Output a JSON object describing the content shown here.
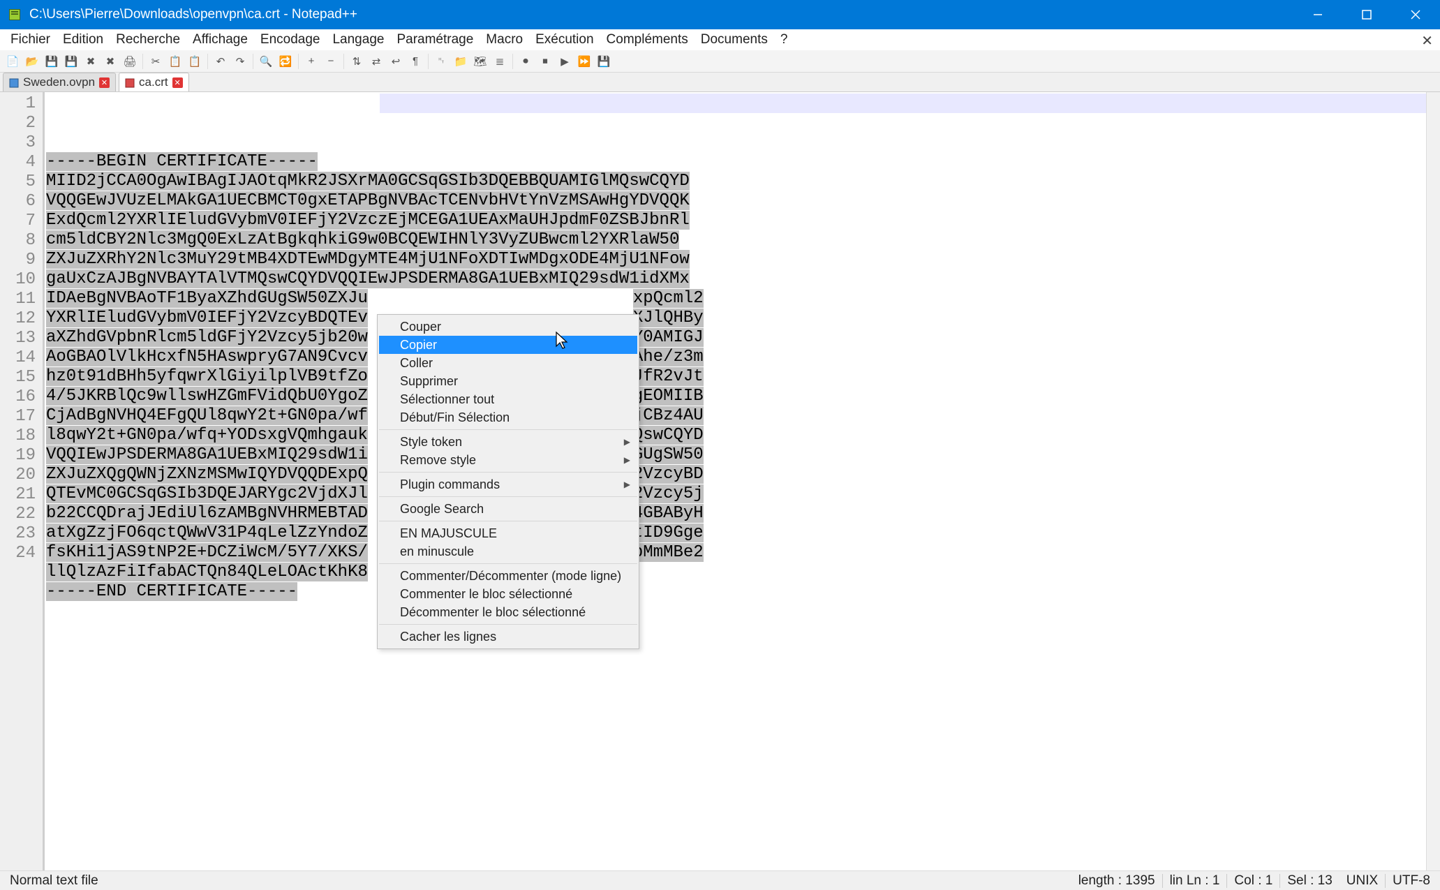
{
  "window": {
    "title": "C:\\Users\\Pierre\\Downloads\\openvpn\\ca.crt - Notepad++"
  },
  "menubar": {
    "items": [
      "Fichier",
      "Edition",
      "Recherche",
      "Affichage",
      "Encodage",
      "Langage",
      "Paramétrage",
      "Macro",
      "Exécution",
      "Compléments",
      "Documents",
      "?"
    ]
  },
  "toolbar_icons": [
    {
      "name": "new-file-icon",
      "glyph": "📄"
    },
    {
      "name": "open-file-icon",
      "glyph": "📂"
    },
    {
      "name": "save-icon",
      "glyph": "💾"
    },
    {
      "name": "save-all-icon",
      "glyph": "💾"
    },
    {
      "name": "close-icon",
      "glyph": "✖"
    },
    {
      "name": "close-all-icon",
      "glyph": "✖"
    },
    {
      "name": "print-icon",
      "glyph": "🖨"
    },
    {
      "sep": true
    },
    {
      "name": "cut-icon",
      "glyph": "✂"
    },
    {
      "name": "copy-icon",
      "glyph": "📋"
    },
    {
      "name": "paste-icon",
      "glyph": "📋"
    },
    {
      "sep": true
    },
    {
      "name": "undo-icon",
      "glyph": "↶"
    },
    {
      "name": "redo-icon",
      "glyph": "↷"
    },
    {
      "sep": true
    },
    {
      "name": "find-icon",
      "glyph": "🔍"
    },
    {
      "name": "replace-icon",
      "glyph": "🔁"
    },
    {
      "sep": true
    },
    {
      "name": "zoom-in-icon",
      "glyph": "+"
    },
    {
      "name": "zoom-out-icon",
      "glyph": "−"
    },
    {
      "sep": true
    },
    {
      "name": "sync-v-icon",
      "glyph": "⇅"
    },
    {
      "name": "sync-h-icon",
      "glyph": "⇄"
    },
    {
      "name": "wrap-icon",
      "glyph": "↩"
    },
    {
      "name": "show-all-chars-icon",
      "glyph": "¶"
    },
    {
      "sep": true
    },
    {
      "name": "indent-guide-icon",
      "glyph": "␉"
    },
    {
      "name": "folder-as-workspace-icon",
      "glyph": "📁"
    },
    {
      "name": "doc-map-icon",
      "glyph": "🗺"
    },
    {
      "name": "func-list-icon",
      "glyph": "≣"
    },
    {
      "sep": true
    },
    {
      "name": "record-macro-icon",
      "glyph": "⏺"
    },
    {
      "name": "stop-macro-icon",
      "glyph": "⏹"
    },
    {
      "name": "play-macro-icon",
      "glyph": "▶"
    },
    {
      "name": "play-multi-icon",
      "glyph": "⏩"
    },
    {
      "name": "save-macro-icon",
      "glyph": "💾"
    }
  ],
  "tabs": [
    {
      "label": "Sweden.ovpn",
      "active": false,
      "dirty": false
    },
    {
      "label": "ca.crt",
      "active": true,
      "dirty": true
    }
  ],
  "lines_full": [
    "-----BEGIN CERTIFICATE-----",
    "MIID2jCCA0OgAwIBAgIJAOtqMkR2JSXrMA0GCSqGSIb3DQEBBQUAMIGlMQswCQYD",
    "VQQGEwJVUzELMAkGA1UECBMCT0gxETAPBgNVBAcTCENvbHVtYnVzMSAwHgYDVQQK",
    "ExdQcml2YXRlIEludGVybmV0IEFjY2VzczEjMCEGA1UEAxMaUHJpdmF0ZSBJbnRl",
    "cm5ldCBY2Nlc3MgQ0ExLzAtBgkqhkiG9w0BCQEWIHNlY3VyZUBwcml2YXRlaW50",
    "ZXJuZXRhY2Nlc3MuY29tMB4XDTEwMDgyMTE4MjU1NFoXDTIwMDgxODE4MjU1NFow",
    "gaUxCzAJBgNVBAYTAlVTMQswCQYDVQQIEwJPSDERMA8GA1UEBxMIQ29sdW1idXMx",
    "IDAeBgNVBAoTF1ByaXZhdGUgSW50ZXJu",
    "YXRlIEludGVybmV0IEFjY2VzcyBDQTEv",
    "aXZhdGVpbnRlcm5ldGFjY2Vzcy5jb20w",
    "AoGBAOlVlkHcxfN5HAswpryG7AN9Cvcv",
    "hz0t91dBHh5yfqwrXlGiyilplVB9tfZo",
    "4/5JKRBlQc9wllswHZGmFVidQbU0YgoZ",
    "CjAdBgNVHQ4EFgQUl8qwY2t+GN0pa/wf",
    "l8qwY2t+GN0pa/wfq+YODsxgVQmhgauk",
    "VQQIEwJPSDERMA8GA1UEBxMIQ29sdW1i",
    "ZXJuZXQgQWNjZXNzMSMwIQYDVQQDExpQ",
    "QTEvMC0GCSqGSIb3DQEJARYgc2VjdXJl",
    "b22CCQDrajJEdiUl6zAMBgNVHRMEBTAD",
    "atXgZzjFO6qctQWwV31P4qLelZzYndoZ",
    "fsKHi1jAS9tNP2E+DCZiWcM/5Y7/XKS/",
    "llQlzAzFiIfabACTQn84QLeLOActKhK8",
    "-----END CERTIFICATE-----",
    ""
  ],
  "lines_right": [
    "",
    "",
    "",
    "",
    "",
    "",
    "",
    "xpQcml2",
    "XJlQHBy",
    "Y0AMIGJ",
    "Ahe/z3m",
    "JfR2vJt",
    "gEOMIIB",
    "jCBz4AU",
    "QswCQYD",
    "GUgSW50",
    "2VzcyBD",
    "2Vzcy5j",
    "4GBAByH",
    "tID9Gge",
    "bMmMBe2",
    "",
    "",
    ""
  ],
  "context_menu": {
    "items": [
      {
        "label": "Couper",
        "hover": false
      },
      {
        "label": "Copier",
        "hover": true
      },
      {
        "label": "Coller",
        "hover": false
      },
      {
        "label": "Supprimer",
        "hover": false
      },
      {
        "label": "Sélectionner tout",
        "hover": false
      },
      {
        "label": "Début/Fin Sélection",
        "hover": false
      },
      {
        "sep": true
      },
      {
        "label": "Style token",
        "sub": true
      },
      {
        "label": "Remove style",
        "sub": true
      },
      {
        "sep": true
      },
      {
        "label": "Plugin commands",
        "sub": true
      },
      {
        "sep": true
      },
      {
        "label": "Google Search",
        "hover": false
      },
      {
        "sep": true
      },
      {
        "label": "EN MAJUSCULE",
        "hover": false
      },
      {
        "label": "en minuscule",
        "hover": false
      },
      {
        "sep": true
      },
      {
        "label": "Commenter/Décommenter (mode ligne)",
        "hover": false
      },
      {
        "label": "Commenter le bloc sélectionné",
        "hover": false
      },
      {
        "label": "Décommenter le bloc sélectionné",
        "hover": false
      },
      {
        "sep": true
      },
      {
        "label": "Cacher les lignes",
        "hover": false
      }
    ]
  },
  "status": {
    "filetype": "Normal text file",
    "length": "length : 1395",
    "lines": "lin Ln : 1",
    "col": "Col : 1",
    "sel": "Sel : 13",
    "eol": "UNIX",
    "enc": "UTF-8"
  }
}
